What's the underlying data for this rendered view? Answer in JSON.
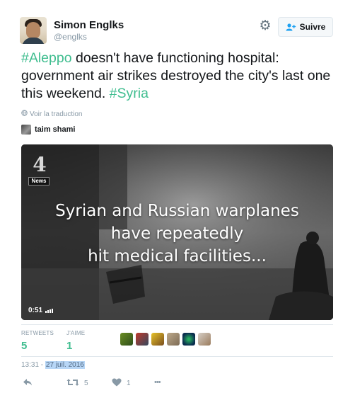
{
  "author": {
    "name": "Simon Englks",
    "handle": "@englks"
  },
  "follow_button": {
    "label": "Suivre"
  },
  "tweet": {
    "hashtag1": "#Aleppo",
    "text_part1": " doesn't have functioning hospital: government air strikes destroyed the city's last one this weekend. ",
    "hashtag2": "#Syria"
  },
  "translate_link": "Voir la traduction",
  "quoted_user": "taim shami",
  "video": {
    "logo_text": "News",
    "logo_glyph": "4",
    "caption_line1": "Syrian and Russian warplanes",
    "caption_line2": "have repeatedly",
    "caption_line3": "hit medical facilities...",
    "duration": "0:51"
  },
  "stats": {
    "retweets_label": "RETWEETS",
    "retweets_value": "5",
    "likes_label": "J'AIME",
    "likes_value": "1"
  },
  "timestamp": {
    "time": "13:31 - ",
    "date": "27 juil. 2016"
  },
  "actions": {
    "retweet_count": "5",
    "like_count": "1",
    "more": "•••"
  },
  "colors": {
    "accent": "#3fbd8f",
    "muted": "#8899a6",
    "selection": "#b7d6f6"
  },
  "icons": {
    "settings": "gear-icon",
    "follow": "add-user-icon",
    "translate": "globe-icon",
    "reply": "reply-icon",
    "retweet": "retweet-icon",
    "like": "heart-icon",
    "more": "more-icon",
    "volume": "volume-bars-icon"
  }
}
